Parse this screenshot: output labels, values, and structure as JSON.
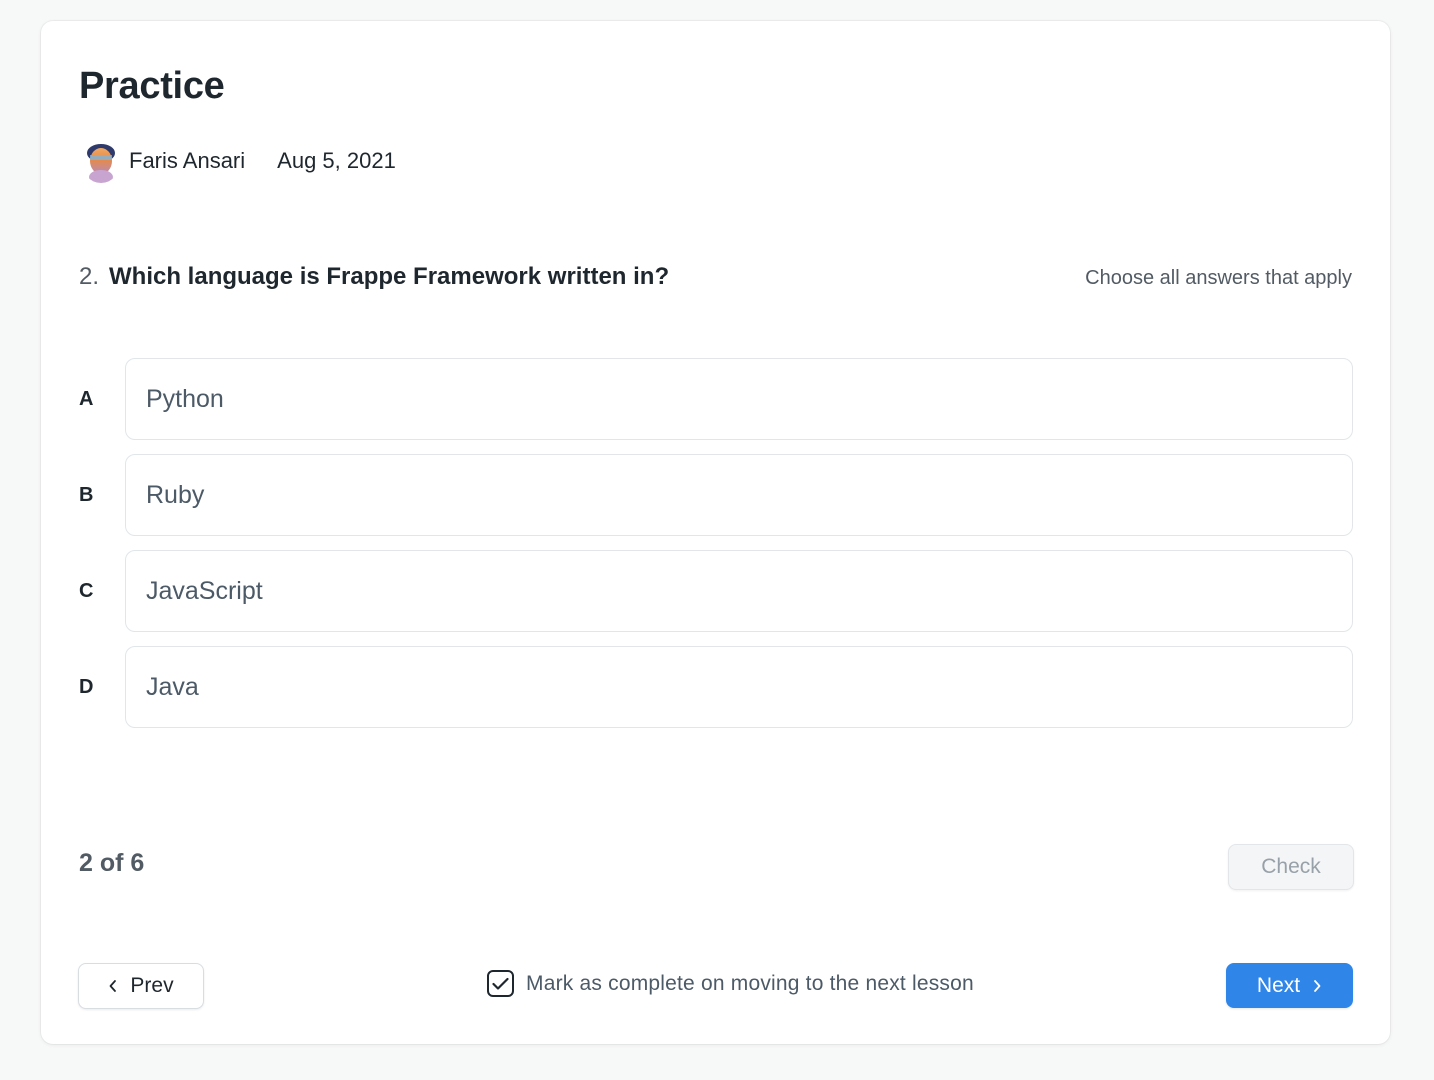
{
  "page": {
    "title": "Practice"
  },
  "meta": {
    "author": "Faris Ansari",
    "date": "Aug 5, 2021"
  },
  "question": {
    "number": "2.",
    "text": "Which language is Frappe Framework written in?",
    "hint": "Choose all answers that apply"
  },
  "options": [
    {
      "letter": "A",
      "text": "Python"
    },
    {
      "letter": "B",
      "text": "Ruby"
    },
    {
      "letter": "C",
      "text": "JavaScript"
    },
    {
      "letter": "D",
      "text": "Java"
    }
  ],
  "footer": {
    "progress": "2 of 6",
    "check_label": "Check",
    "prev_label": "Prev",
    "next_label": "Next",
    "mark_complete_label": "Mark as complete on moving to the next lesson",
    "mark_complete_checked": true
  },
  "colors": {
    "accent": "#2f85e8",
    "text": "#1f272e",
    "muted": "#525b64",
    "border": "#e2e6e9",
    "background": "#f7f8f8"
  },
  "icons": {
    "prev": "chevron-left-icon",
    "next": "chevron-right-icon",
    "checkbox": "checkmark-icon"
  }
}
